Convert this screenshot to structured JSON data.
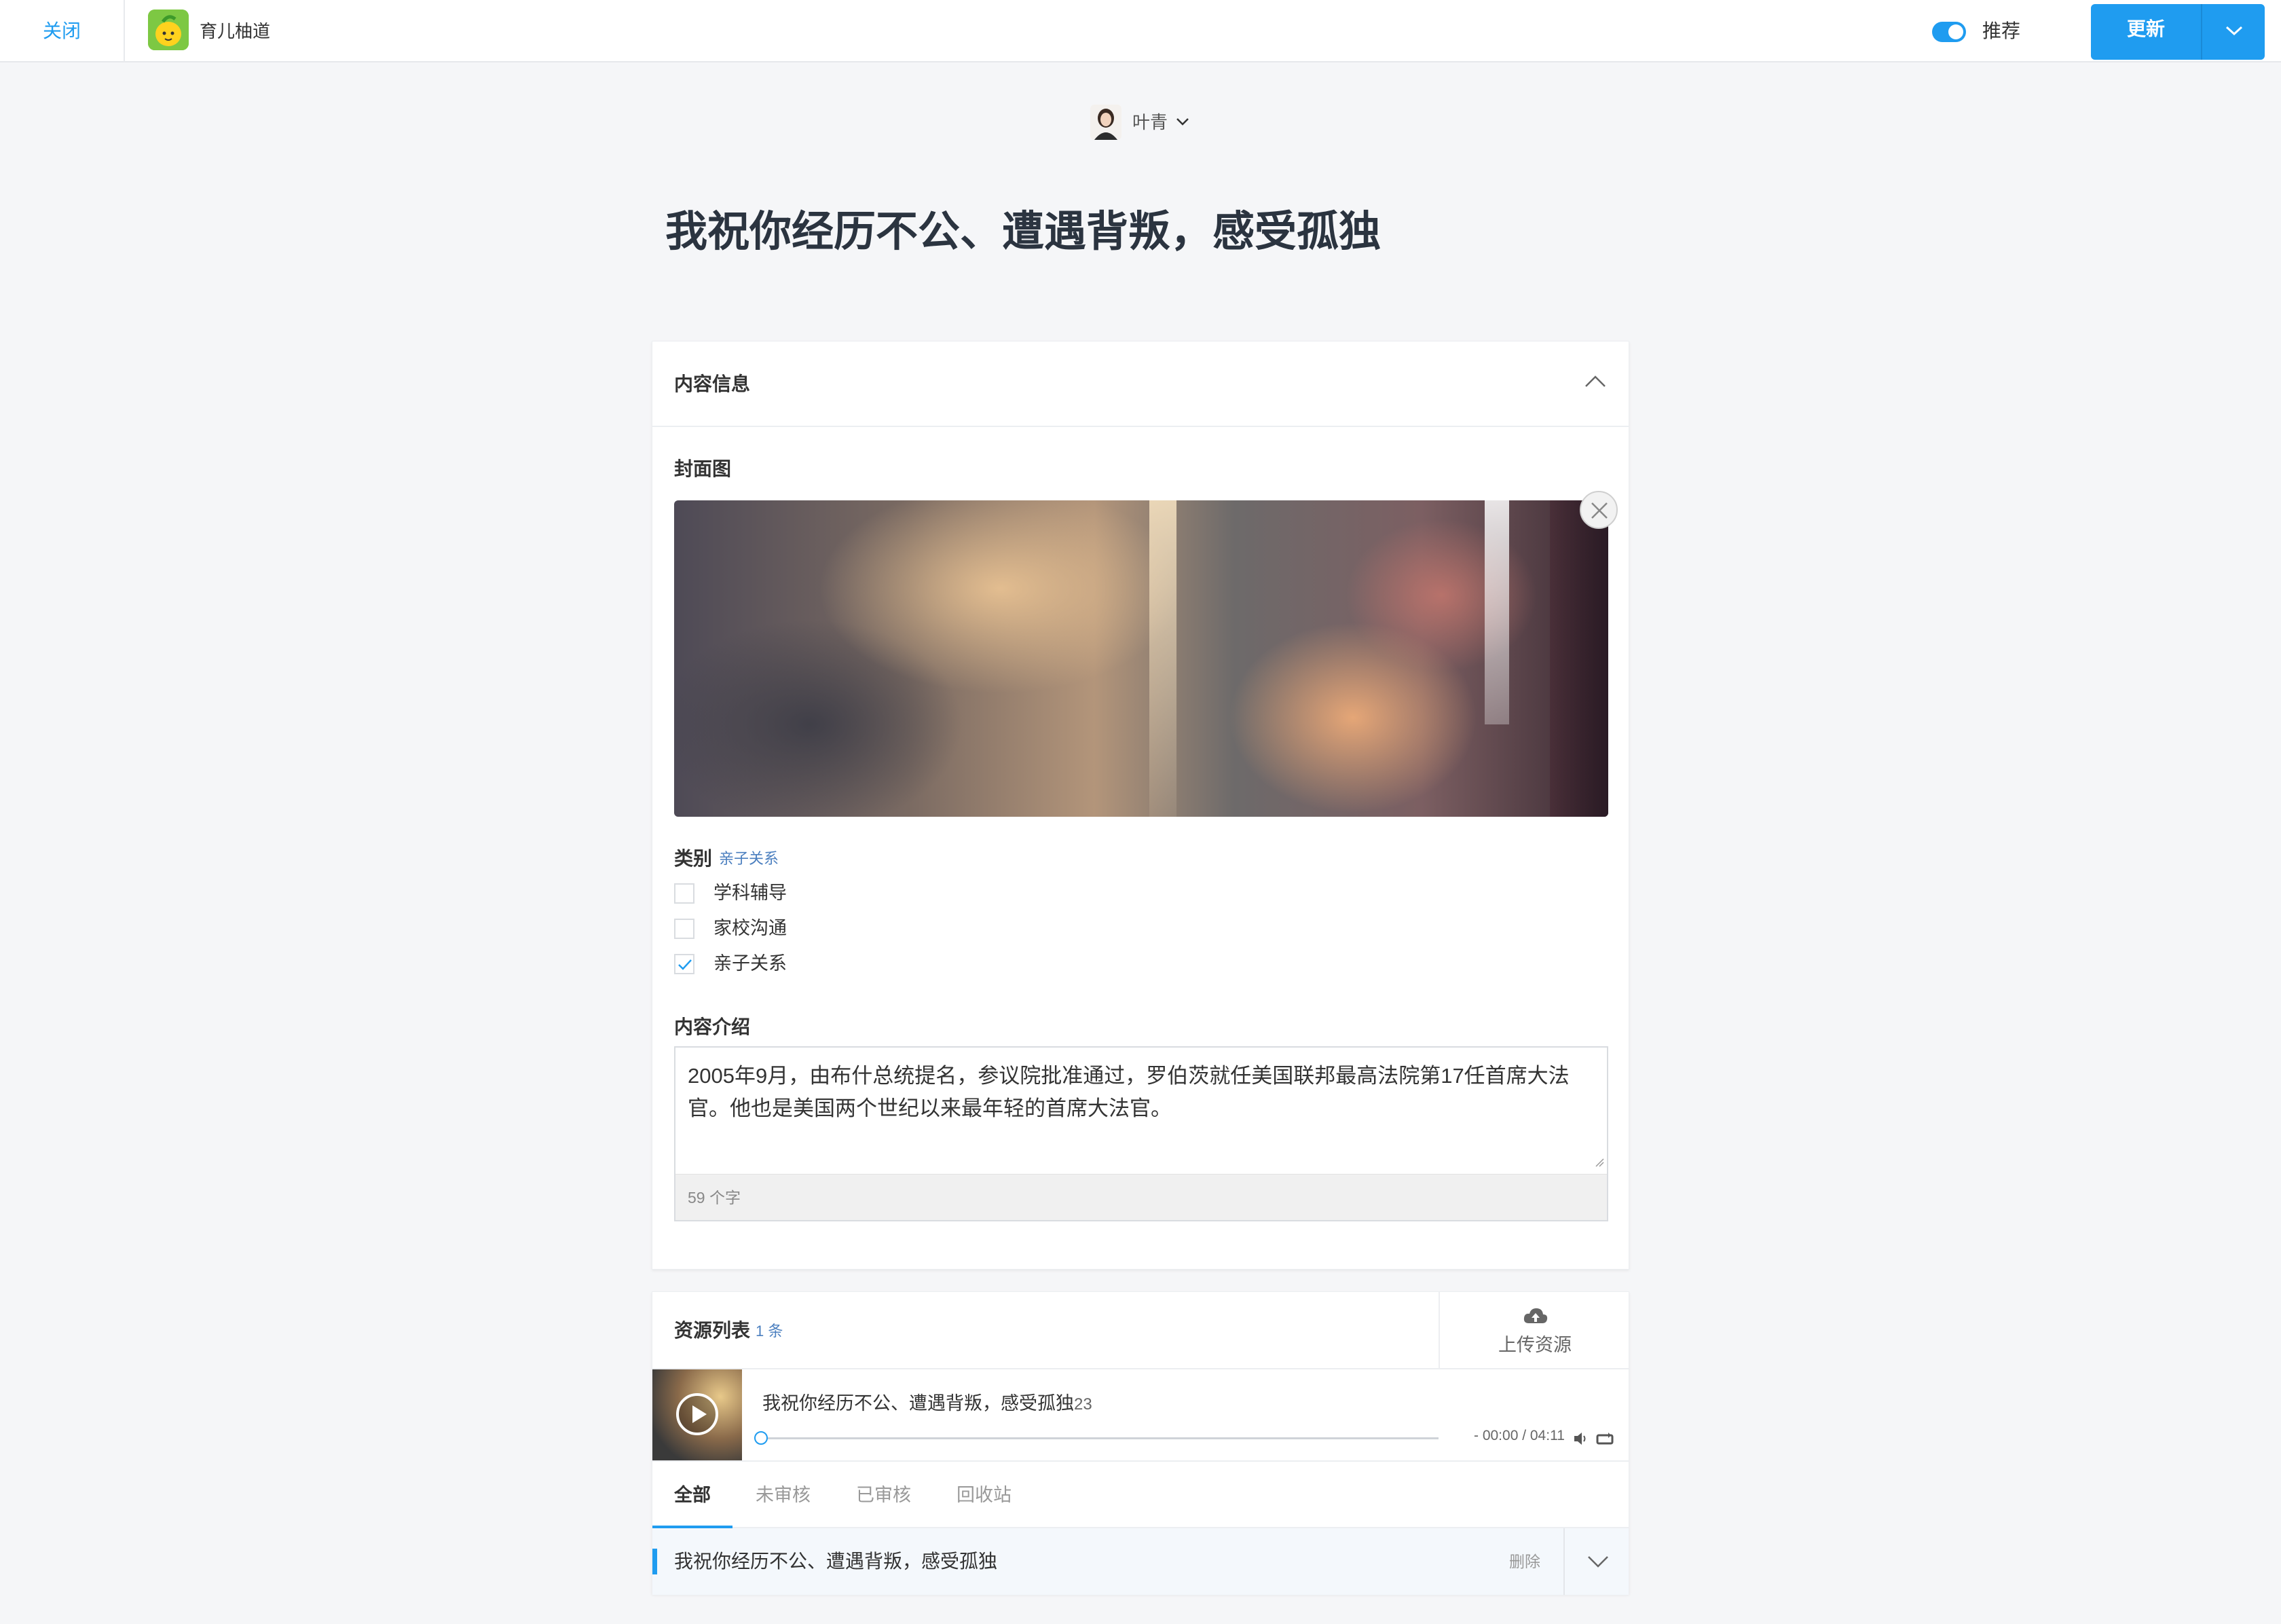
{
  "topbar": {
    "close_label": "关闭",
    "app_name": "育儿柚道",
    "toggle_label": "推荐",
    "toggle_on": true,
    "update_label": "更新"
  },
  "author": {
    "name": "叶青"
  },
  "article": {
    "title": "我祝你经历不公、遭遇背叛，感受孤独"
  },
  "content_info": {
    "header": "内容信息",
    "cover_label": "封面图",
    "category_label": "类别",
    "category_selected": "亲子关系",
    "categories": [
      {
        "label": "学科辅导",
        "checked": false
      },
      {
        "label": "家校沟通",
        "checked": false
      },
      {
        "label": "亲子关系",
        "checked": true
      }
    ],
    "description_label": "内容介绍",
    "description": "2005年9月，由布什总统提名，参议院批准通过，罗伯茨就任美国联邦最高法院第17任首席大法官。他也是美国两个世纪以来最年轻的首席大法官。",
    "char_count": "59 个字"
  },
  "resources": {
    "header": "资源列表",
    "count": "1 条",
    "upload_label": "上传资源",
    "track": {
      "title": "我祝你经历不公、遭遇背叛，感受孤独",
      "suffix": "23",
      "time": "- 00:00 / 04:11",
      "progress": 0
    },
    "tabs": [
      "全部",
      "未审核",
      "已审核",
      "回收站"
    ],
    "active_tab": "全部",
    "items": [
      {
        "title": "我祝你经历不公、遭遇背叛，感受孤独",
        "delete_label": "删除"
      }
    ]
  },
  "colors": {
    "accent": "#1f9cf0",
    "page_bg": "#f5f6f8",
    "title_text": "#2b3440",
    "tag_text": "#4b7fbf"
  },
  "icons": {
    "collapse": "chevron-up-icon",
    "remove_cover": "close-circle-icon",
    "upload": "cloud-upload-icon",
    "play": "play-circle-icon",
    "volume": "volume-icon",
    "loop": "loop-icon",
    "expand": "chevron-down-icon"
  }
}
